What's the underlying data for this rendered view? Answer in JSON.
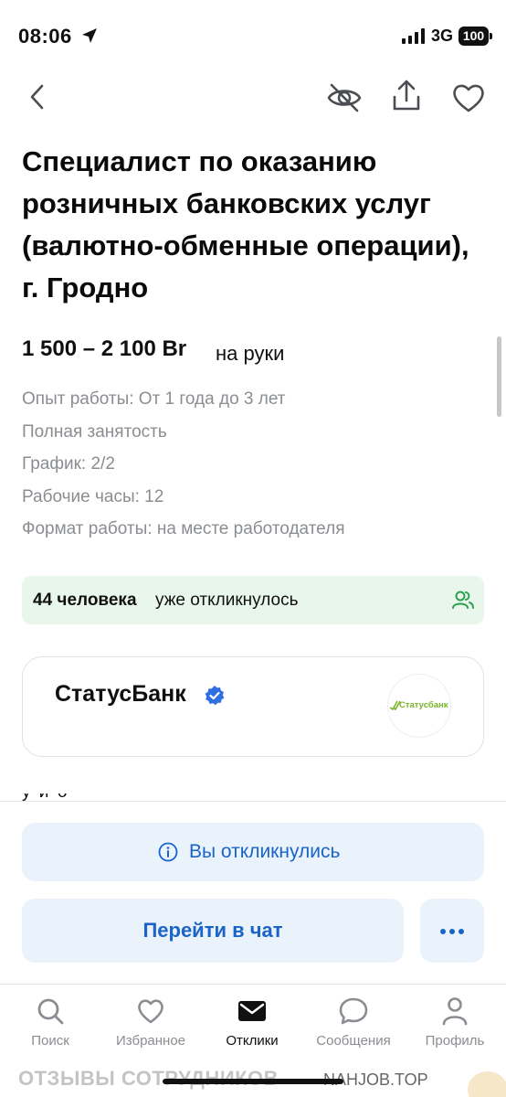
{
  "status_bar": {
    "time": "08:06",
    "network": "3G",
    "battery": "100"
  },
  "nav": {
    "back_icon": "chevron-left-icon",
    "hide_icon": "eye-off-icon",
    "share_icon": "share-icon",
    "favorite_icon": "heart-icon"
  },
  "vacancy": {
    "title": "Специалист по оказанию розничных банковских услуг (валютно-обменные операции), г. Гродно",
    "salary": "1 500 – 2 100 Br",
    "salary_note": "на руки",
    "details": [
      "Опыт работы: От 1 года до 3 лет",
      "Полная занятость",
      "График: 2/2",
      "Рабочие часы: 12",
      "Формат работы: на месте работодателя"
    ]
  },
  "responses": {
    "count": "44 человека",
    "text": "уже откликнулось"
  },
  "company": {
    "name": "СтатусБанк",
    "logo_text": "Статусбанк"
  },
  "actions": {
    "responded_label": "Вы откликнулись",
    "chat_label": "Перейти в чат"
  },
  "tabs": [
    {
      "label": "Поиск",
      "icon": "search-icon"
    },
    {
      "label": "Избранное",
      "icon": "heart-icon"
    },
    {
      "label": "Отклики",
      "icon": "envelope-icon"
    },
    {
      "label": "Сообщения",
      "icon": "chat-bubble-icon"
    },
    {
      "label": "Профиль",
      "icon": "person-icon"
    }
  ],
  "watermark": {
    "left": "ОТЗЫВЫ СОТРУДНИКОВ",
    "right": "NAHJOB.TOP"
  },
  "colors": {
    "accent_blue": "#1a64c8",
    "button_bg": "#eaf2fc",
    "banner_green_bg": "#e9f6ec",
    "people_icon_green": "#2e9f4e",
    "verified_blue": "#2f6fe4",
    "muted_text": "#8a8d91"
  }
}
